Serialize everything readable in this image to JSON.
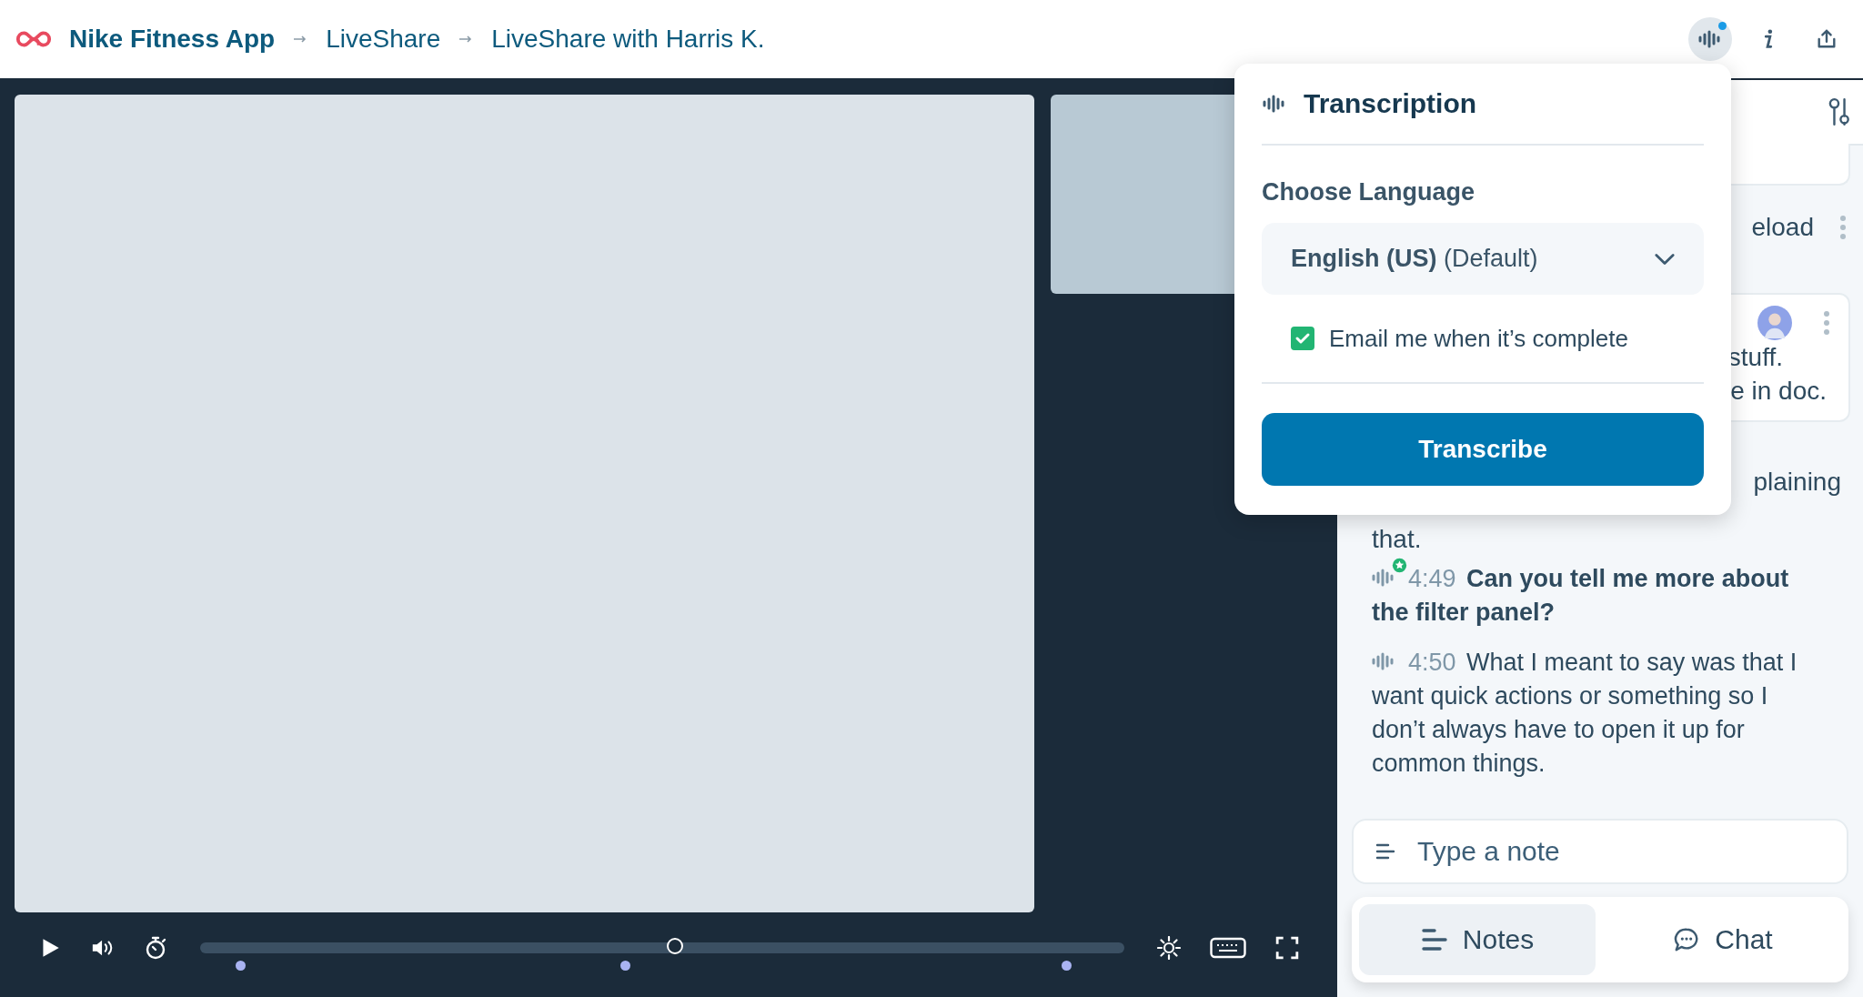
{
  "app": {
    "brand": "Nike Fitness App",
    "breadcrumbs": [
      "LiveShare",
      "LiveShare with Harris K."
    ]
  },
  "toolbar": [
    {
      "kind": "transcription",
      "selected": true,
      "notification": true
    },
    {
      "kind": "info",
      "selected": false
    },
    {
      "kind": "share",
      "selected": false
    }
  ],
  "player": {
    "level": 0.514,
    "markers": [
      {
        "level": 0.043
      },
      {
        "level": 0.46
      },
      {
        "level": 0.937
      }
    ]
  },
  "popup": {
    "title": "Transcription",
    "label": "Choose Language",
    "language": {
      "value": "English (US)",
      "suffix": "(Default)"
    },
    "email_option": {
      "label": "Email me when it’s complete",
      "checked": true
    },
    "button": "Transcribe"
  },
  "panel": {
    "partial_row": "eload",
    "partial_card": [
      "stuff.",
      "e in doc."
    ],
    "partial_text": [
      "plaining",
      "that."
    ],
    "entries": [
      {
        "time": "4:49",
        "text": "Can you tell me more about the filter panel?",
        "starred": true,
        "highlighted": true
      },
      {
        "time": "4:50",
        "text": "What I meant to say was that I want quick actions or something so I don’t always have to open it up for common things.",
        "starred": false,
        "highlighted": false
      }
    ],
    "note": {
      "placeholder": "Type a note"
    },
    "tabs": [
      {
        "kind": "notes",
        "label": "Notes",
        "selected": true
      },
      {
        "kind": "chat",
        "label": "Chat",
        "selected": false
      }
    ]
  }
}
